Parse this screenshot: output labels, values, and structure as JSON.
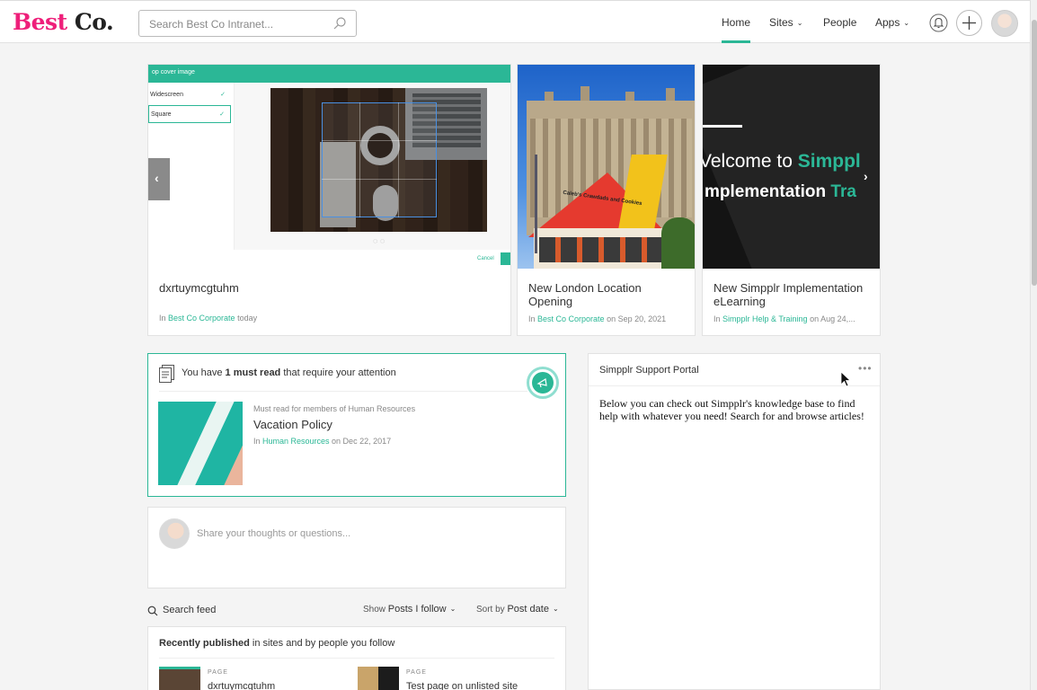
{
  "header": {
    "logo_part1": "Best",
    "logo_part2": "Co.",
    "search_placeholder": "Search Best Co Intranet...",
    "nav": [
      {
        "label": "Home",
        "active": true
      },
      {
        "label": "Sites",
        "dropdown": true
      },
      {
        "label": "People"
      },
      {
        "label": "Apps",
        "dropdown": true
      }
    ],
    "icons": [
      "search-icon",
      "bell-icon",
      "plus-icon",
      "avatar"
    ],
    "accent_color": "#2bb796",
    "logo_color": "#ee1f7a"
  },
  "carousel": {
    "cards": [
      {
        "title": "dxrtuymcgtuhm",
        "meta_prefix": "In ",
        "site": "Best Co Corporate",
        "meta_suffix": " today",
        "image": {
          "header": "op cover image",
          "options": [
            "Widescreen",
            "Square"
          ],
          "cancel": "Cancel"
        }
      },
      {
        "title_line1": "New London Location",
        "title_line2": "Opening",
        "meta_prefix": "In ",
        "site": "Best Co Corporate",
        "meta_suffix": " on Sep 20, 2021",
        "image": {
          "sign": "Caleb's Crawdads and Cookies"
        }
      },
      {
        "title_line1": "New Simpplr Implementation",
        "title_line2": "eLearning",
        "meta_prefix": "In ",
        "site": "Simpplr Help & Training",
        "meta_suffix": " on Aug 24,...",
        "image": {
          "line1_a": "Velcome to ",
          "line1_b": "Simppl",
          "line2_a": "mplementation ",
          "line2_b": "Tra"
        }
      }
    ]
  },
  "must_read": {
    "head_prefix": "You have ",
    "head_bold": "1 must read",
    "head_suffix": " that require your attention",
    "item": {
      "subtitle": "Must read for members of Human Resources",
      "title": "Vacation Policy",
      "meta_prefix": "In ",
      "site": "Human Resources",
      "meta_suffix": " on Dec 22, 2017"
    }
  },
  "composer": {
    "placeholder": "Share your thoughts or questions..."
  },
  "feed_controls": {
    "search_label": "Search feed",
    "show_label": "Show ",
    "show_value": "Posts I follow",
    "sort_label": "Sort by ",
    "sort_value": "Post date"
  },
  "recent": {
    "head_bold": "Recently published",
    "head_rest": " in sites and by people you follow",
    "items": [
      {
        "type": "PAGE",
        "title": "dxrtuymcgtuhm"
      },
      {
        "type": "PAGE",
        "title": "Test page on unlisted site"
      }
    ]
  },
  "portal": {
    "title": "Simpplr Support Portal",
    "body": "Below you can check out Simpplr's knowledge base to find help with whatever you need! Search for and browse articles!"
  }
}
